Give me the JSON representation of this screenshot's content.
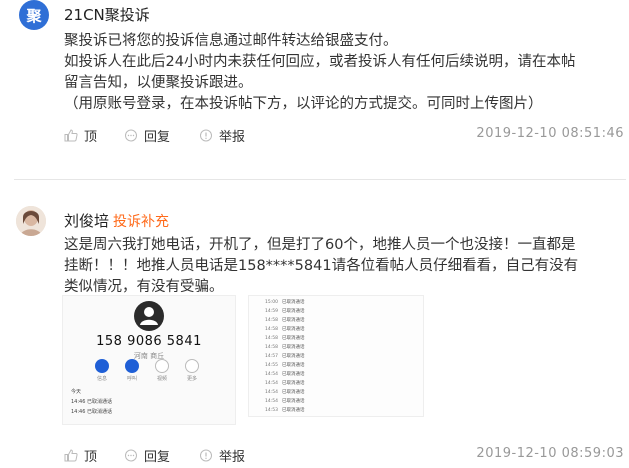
{
  "posts": [
    {
      "author": "21CN聚投诉",
      "avatar_text": "聚",
      "lines": [
        "聚投诉已将您的投诉信息通过邮件转达给银盛支付。",
        "如投诉人在此后24小时内未获任何回应，或者投诉人有任何后续说明，请在本帖",
        "留言告知，以便聚投诉跟进。",
        "（用原账号登录，在本投诉帖下方，以评论的方式提交。可同时上传图片）"
      ],
      "actions": {
        "like": "顶",
        "reply": "回复",
        "report": "举报"
      },
      "timestamp": "2019-12-10 08:51:46"
    },
    {
      "author": "刘俊培",
      "tag": "投诉补充",
      "lines": [
        "这是周六我打她电话，开机了，但是打了60个，地推人员一个也没接！一直都是",
        "挂断！！！地推人员电话是158****5841请各位看帖人员仔细看看，自己有没有",
        "类似情况，有没有受骗。"
      ],
      "screenshot1": {
        "number": "158 9086 5841",
        "location": "河南 商丘",
        "buttons": [
          "信息",
          "呼叫",
          "视频",
          "更多"
        ],
        "today": "今天",
        "log": [
          {
            "time": "14:46",
            "text": "已取消通话"
          },
          {
            "time": "14:46",
            "text": "已取消通话"
          }
        ]
      },
      "screenshot2": {
        "log": [
          {
            "time": "15:00",
            "text": "已取消通话"
          },
          {
            "time": "14:59",
            "text": "已取消通话"
          },
          {
            "time": "14:58",
            "text": "已取消通话"
          },
          {
            "time": "14:58",
            "text": "已取消通话"
          },
          {
            "time": "14:58",
            "text": "已取消通话"
          },
          {
            "time": "14:58",
            "text": "已取消通话"
          },
          {
            "time": "14:57",
            "text": "已取消通话"
          },
          {
            "time": "14:55",
            "text": "已取消通话"
          },
          {
            "time": "14:54",
            "text": "已取消通话"
          },
          {
            "time": "14:54",
            "text": "已取消通话"
          },
          {
            "time": "14:54",
            "text": "已取消通话"
          },
          {
            "time": "14:54",
            "text": "已取消通话"
          },
          {
            "time": "14:53",
            "text": "已取消通话"
          }
        ]
      },
      "actions": {
        "like": "顶",
        "reply": "回复",
        "report": "举报"
      },
      "timestamp": "2019-12-10 08:59:03"
    }
  ],
  "colors": {
    "accent_orange": "#ff6a1a",
    "brand_blue": "#2f6fd6",
    "call_blue": "#1f5fd6"
  }
}
